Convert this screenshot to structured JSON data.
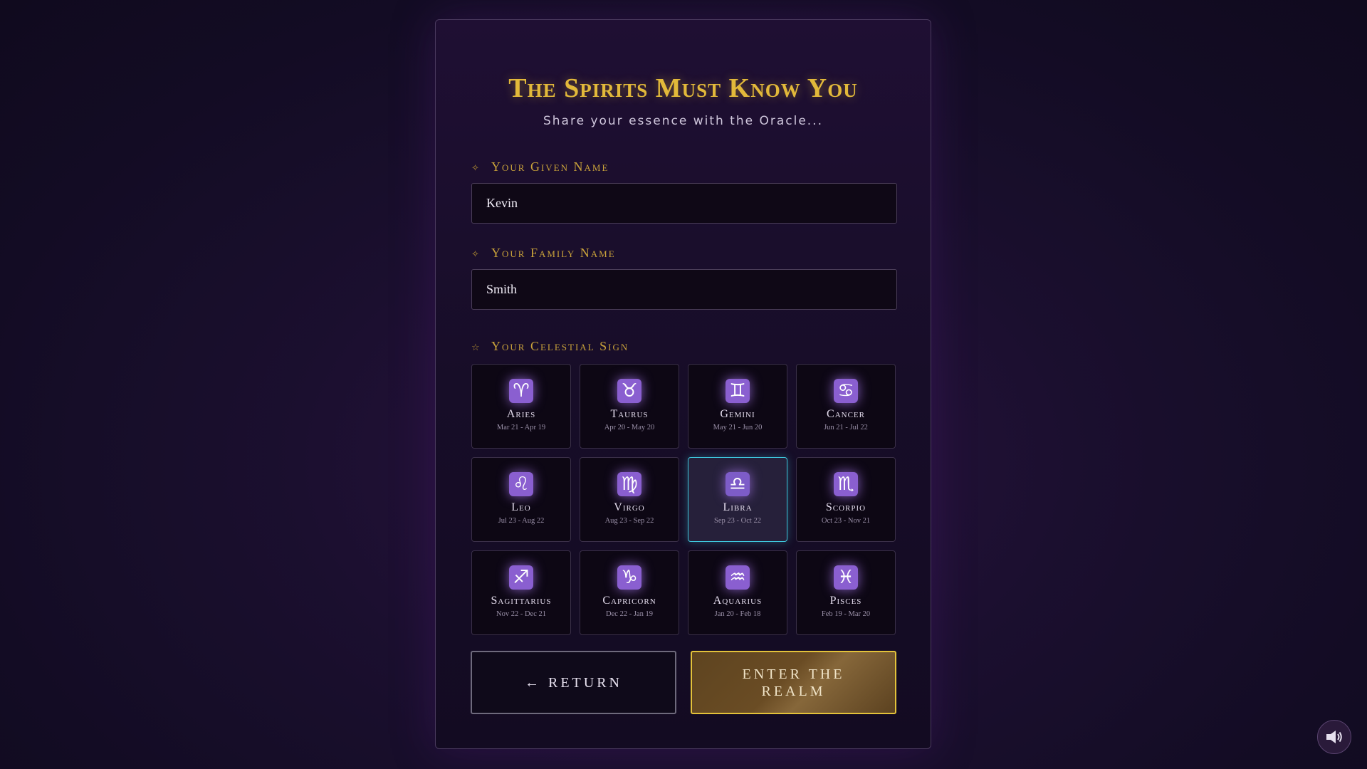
{
  "header": {
    "title": "The Spirits Must Know You",
    "subtitle": "Share your essence with the Oracle..."
  },
  "form": {
    "given_name": {
      "icon": "diamond-sparkle-icon",
      "mark": "✧",
      "label": "Your Given Name",
      "value": "Kevin"
    },
    "family_name": {
      "icon": "diamond-sparkle-icon",
      "mark": "✧",
      "label": "Your Family Name",
      "value": "Smith"
    },
    "celestial_sign": {
      "icon": "star-outline-icon",
      "mark": "☆",
      "label": "Your Celestial Sign",
      "selected": "Libra",
      "signs": [
        {
          "name": "Aries",
          "symbol": "♈",
          "dates": "Mar 21 - Apr 19",
          "icon": "aries-icon"
        },
        {
          "name": "Taurus",
          "symbol": "♉",
          "dates": "Apr 20 - May 20",
          "icon": "taurus-icon"
        },
        {
          "name": "Gemini",
          "symbol": "♊",
          "dates": "May 21 - Jun 20",
          "icon": "gemini-icon"
        },
        {
          "name": "Cancer",
          "symbol": "♋",
          "dates": "Jun 21 - Jul 22",
          "icon": "cancer-icon"
        },
        {
          "name": "Leo",
          "symbol": "♌",
          "dates": "Jul 23 - Aug 22",
          "icon": "leo-icon"
        },
        {
          "name": "Virgo",
          "symbol": "♍",
          "dates": "Aug 23 - Sep 22",
          "icon": "virgo-icon"
        },
        {
          "name": "Libra",
          "symbol": "♎",
          "dates": "Sep 23 - Oct 22",
          "icon": "libra-icon"
        },
        {
          "name": "Scorpio",
          "symbol": "♏",
          "dates": "Oct 23 - Nov 21",
          "icon": "scorpio-icon"
        },
        {
          "name": "Sagittarius",
          "symbol": "♐",
          "dates": "Nov 22 - Dec 21",
          "icon": "sagittarius-icon"
        },
        {
          "name": "Capricorn",
          "symbol": "♑",
          "dates": "Dec 22 - Jan 19",
          "icon": "capricorn-icon"
        },
        {
          "name": "Aquarius",
          "symbol": "♒",
          "dates": "Jan 20 - Feb 18",
          "icon": "aquarius-icon"
        },
        {
          "name": "Pisces",
          "symbol": "♓",
          "dates": "Feb 19 - Mar 20",
          "icon": "pisces-icon"
        }
      ]
    }
  },
  "actions": {
    "return_label": "← RETURN",
    "enter_label": "ENTER THE REALM"
  },
  "sound_toggle": {
    "icon": "speaker-volume-icon"
  },
  "colors": {
    "accent_gold": "#e2b93a",
    "selected_border": "#3fc8de",
    "glyph_purple": "#8a5fd0"
  }
}
